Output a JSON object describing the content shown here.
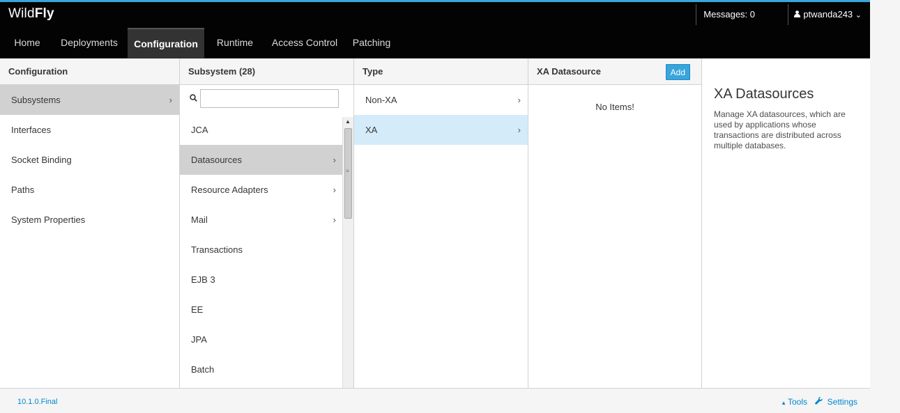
{
  "brand": {
    "prefix": "Wild",
    "bold": "Fly"
  },
  "header": {
    "messages_label": "Messages: 0",
    "user_icon": "user-icon",
    "user_name": "ptwanda243",
    "user_chevron": "⌄"
  },
  "nav": {
    "items": [
      {
        "label": "Home"
      },
      {
        "label": "Deployments"
      },
      {
        "label": "Configuration",
        "active": true
      },
      {
        "label": "Runtime"
      },
      {
        "label": "Access Control"
      },
      {
        "label": "Patching"
      }
    ]
  },
  "col1": {
    "header": "Configuration",
    "items": [
      {
        "label": "Subsystems",
        "chevron": "›"
      },
      {
        "label": "Interfaces"
      },
      {
        "label": "Socket Binding"
      },
      {
        "label": "Paths"
      },
      {
        "label": "System Properties"
      }
    ]
  },
  "col2": {
    "header": "Subsystem (28)",
    "search": {
      "value": "",
      "placeholder": ""
    },
    "items": [
      {
        "label": "JCA"
      },
      {
        "label": "Datasources",
        "chevron": "›"
      },
      {
        "label": "Resource Adapters",
        "chevron": "›"
      },
      {
        "label": "Mail",
        "chevron": "›"
      },
      {
        "label": "Transactions"
      },
      {
        "label": "EJB 3"
      },
      {
        "label": "EE"
      },
      {
        "label": "JPA"
      },
      {
        "label": "Batch"
      }
    ]
  },
  "col3": {
    "header": "Type",
    "items": [
      {
        "label": "Non-XA",
        "chevron": "›"
      },
      {
        "label": "XA",
        "chevron": "›"
      }
    ]
  },
  "col4": {
    "header": "XA Datasource",
    "add_label": "Add",
    "empty_text": "No Items!"
  },
  "preview": {
    "title": "XA Datasources",
    "description": "Manage XA datasources, which are used by applications whose transactions are distributed across multiple databases."
  },
  "footer": {
    "version": "10.1.0.Final",
    "tools_label": "Tools",
    "settings_label": "Settings"
  },
  "colors": {
    "accent": "#39a5dc",
    "header_bg": "#030303",
    "selected_grey": "#d1d1d1",
    "selected_blue": "#d4ecf9",
    "link": "#0088ce"
  }
}
